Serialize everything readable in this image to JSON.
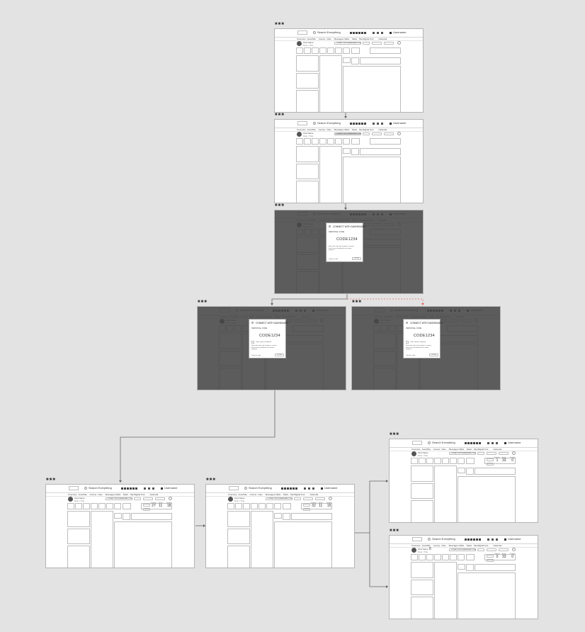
{
  "dots_label": "■■■",
  "wireframe": {
    "search_text": "Search Everything",
    "user_name": "Username",
    "nav_items": [
      "Overview",
      "Area/Site",
      "Course",
      "Files",
      "Messages",
      "Mails",
      "Tasks",
      "Site/Digital Tool",
      "Calendar"
    ],
    "profile_name": "First Name",
    "profile_sub": "Role / Title",
    "copy_code_label": "CONNECT WITH DASHBOARD CODE",
    "btn_a": "RESET",
    "btn_b": "SELECT ALL",
    "btn_c": "SELECT ALL",
    "small_btn": "Add"
  },
  "modal": {
    "title": "CONNECT WITH DASHBOARD",
    "subtitle": "PERSONAL CODE",
    "code": "CODE1234",
    "copied_note": "Code copied to clipboard",
    "body_text": "Share this code with students to connect them to your dashboard and monitor progress.",
    "footer_left": "Copy this code",
    "footer_button": "CLOSE"
  },
  "counters": {
    "labels": [
      "Students",
      "Active",
      "Pending"
    ],
    "frame_b": [
      "27",
      "11",
      "18"
    ],
    "frame_c": [
      "32",
      "11",
      "15"
    ],
    "frame_d": [
      "1",
      "33",
      "0"
    ],
    "frame_e": [
      "0",
      "33",
      "0"
    ]
  },
  "frame_e_extra": "8"
}
